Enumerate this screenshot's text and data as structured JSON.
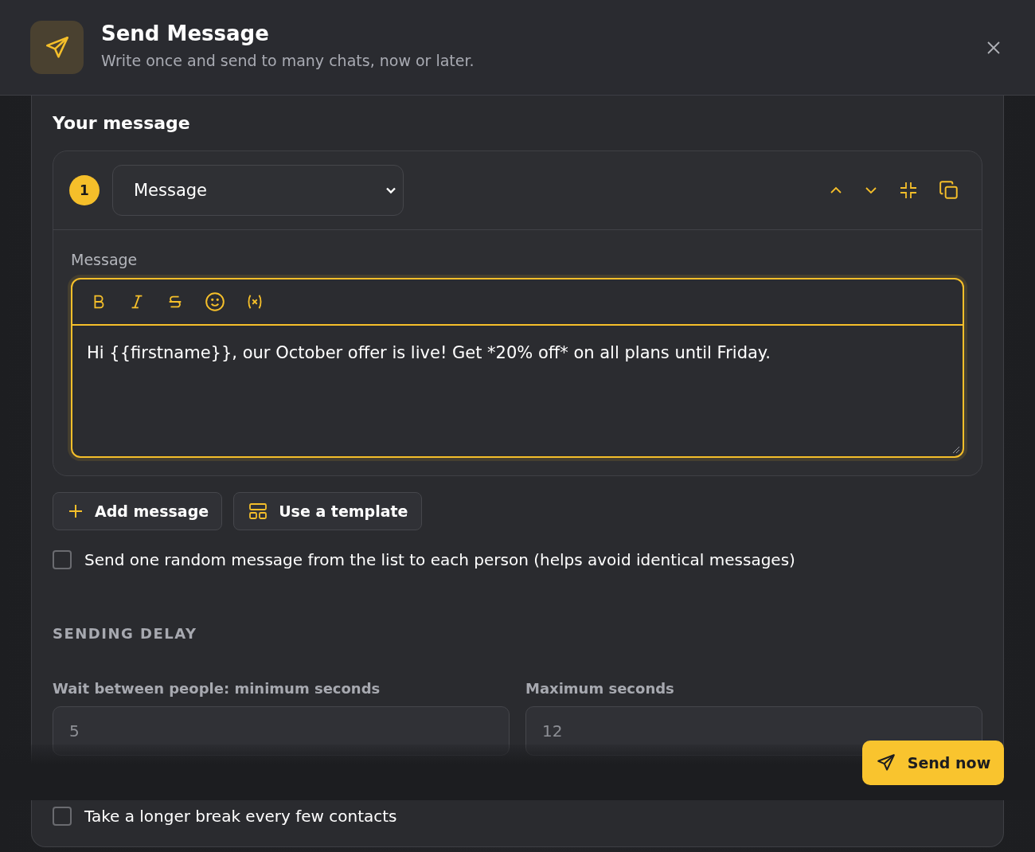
{
  "header": {
    "title": "Send Message",
    "subtitle": "Write once and send to many chats, now or later."
  },
  "section_title": "Your message",
  "message_blocks": [
    {
      "number": "1",
      "type": "Message",
      "field_label": "Message",
      "text": "Hi {{firstname}}, our October offer is live! Get *20% off* on all plans until Friday."
    }
  ],
  "actions": [
    {
      "kind": "add",
      "label": "Add message"
    },
    {
      "kind": "template",
      "label": "Use a template"
    }
  ],
  "random_option": {
    "label": "Send one random message from the list to each person (helps avoid identical messages)",
    "checked": false
  },
  "delay": {
    "heading": "SENDING DELAY",
    "min_label": "Wait between people: minimum seconds",
    "min_value": "5",
    "max_label": "Maximum seconds",
    "max_value": "12"
  },
  "break_option": {
    "label": "Take a longer break every few contacts",
    "checked": false
  },
  "send_button": "Send now"
}
